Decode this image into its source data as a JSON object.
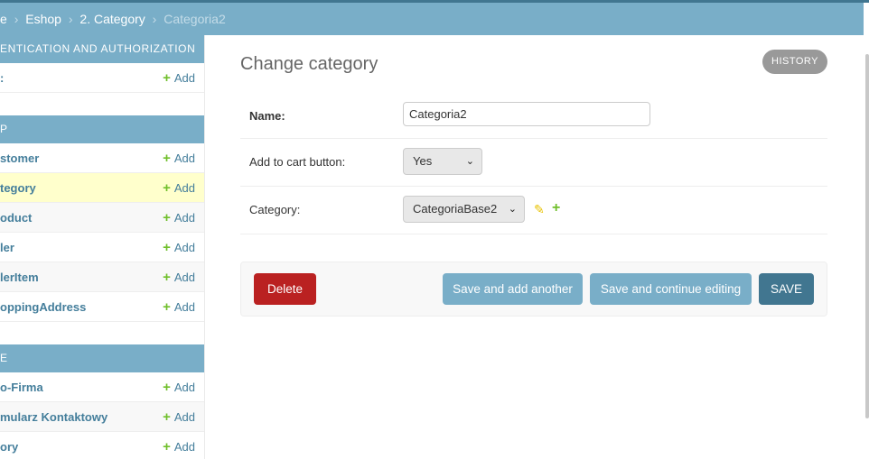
{
  "breadcrumbs": {
    "items": [
      "e",
      "Eshop",
      "2. Category"
    ],
    "separator": "›",
    "current": "Categoria2"
  },
  "sidebar": {
    "apps": [
      {
        "caption": "ENTICATION AND AUTHORIZATION",
        "models": [
          {
            "name": ":",
            "add": "Add"
          }
        ]
      },
      {
        "caption": "P",
        "models": [
          {
            "name": "stomer",
            "add": "Add"
          },
          {
            "name": "tegory",
            "add": "Add",
            "selected": true
          },
          {
            "name": "oduct",
            "add": "Add"
          },
          {
            "name": "ler",
            "add": "Add"
          },
          {
            "name": "lerItem",
            "add": "Add"
          },
          {
            "name": "oppingAddress",
            "add": "Add"
          }
        ]
      },
      {
        "caption": "E",
        "models": [
          {
            "name": "o-Firma",
            "add": "Add"
          },
          {
            "name": "mularz Kontaktowy",
            "add": "Add"
          },
          {
            "name": "ory",
            "add": "Add"
          }
        ]
      }
    ],
    "add_symbol": "+"
  },
  "main": {
    "title": "Change category",
    "history_label": "HISTORY",
    "fields": {
      "name_label": "Name:",
      "name_value": "Categoria2",
      "add_to_cart_label": "Add to cart button:",
      "add_to_cart_value": "Yes",
      "category_label": "Category:",
      "category_value": "CategoriaBase2"
    },
    "related": {
      "edit_symbol": "✎",
      "add_symbol": "+"
    },
    "chevron_symbol": "⌄",
    "buttons": {
      "delete": "Delete",
      "save_add_another": "Save and add another",
      "save_continue": "Save and continue editing",
      "save": "SAVE"
    }
  },
  "colors": {
    "header": "#79aec8",
    "primary": "#417690",
    "link": "#447e9b",
    "add_green": "#70bf2b",
    "delete_red": "#ba2121",
    "selected_row": "#ffffcc"
  }
}
